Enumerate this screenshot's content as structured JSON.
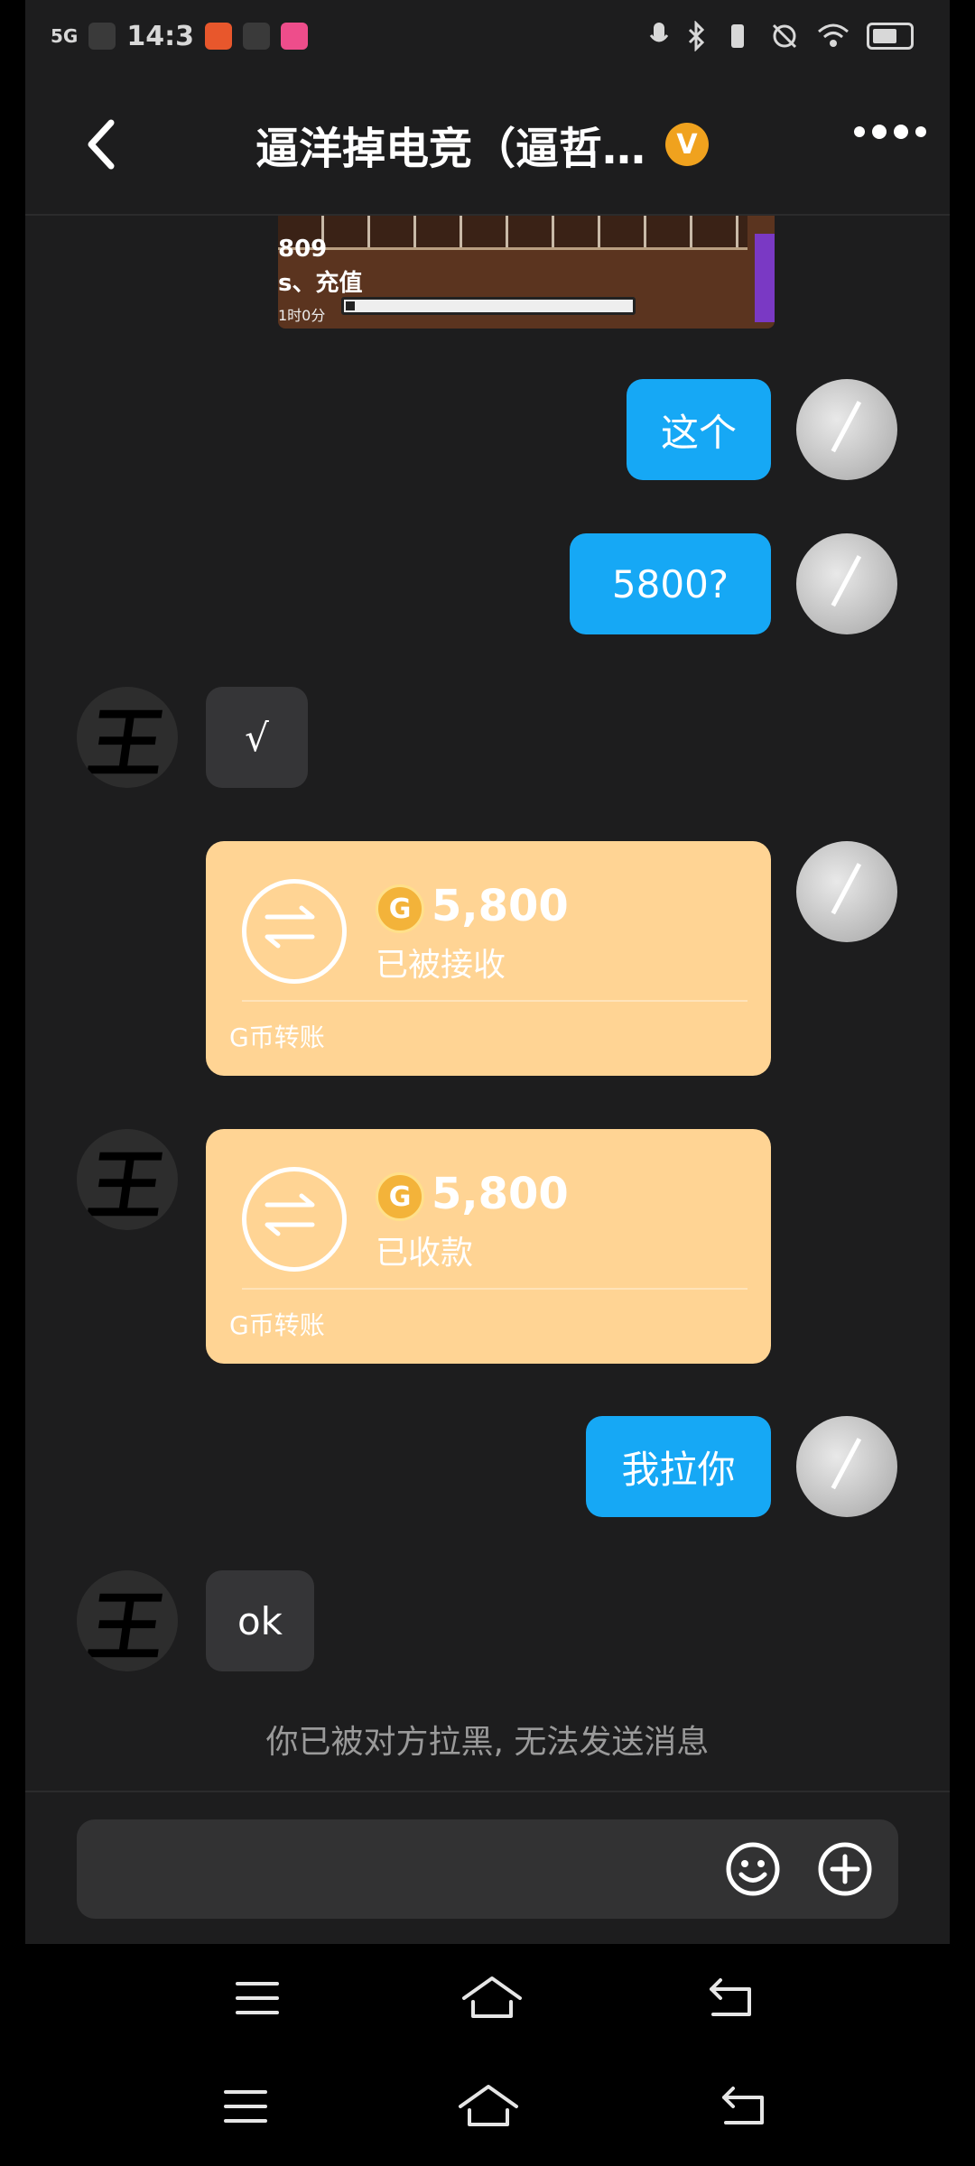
{
  "status_bar": {
    "time": "14:3",
    "network": "5G"
  },
  "header": {
    "title": "逼洋掉电竞（逼哲…",
    "badge": "V",
    "back_icon": "chevron-left-icon",
    "more_icon": "more-dots-icon"
  },
  "image_message": {
    "line1": "809",
    "line2": "s、充值",
    "line3": "1时0分"
  },
  "messages": [
    {
      "sender": "me",
      "text": "这个"
    },
    {
      "sender": "me",
      "text": "5800?"
    },
    {
      "sender": "other",
      "text": "√"
    },
    {
      "sender": "me",
      "type": "transfer",
      "amount": "5,800",
      "status": "已被接收",
      "label": "G币转账",
      "coin": "G"
    },
    {
      "sender": "other",
      "type": "transfer",
      "amount": "5,800",
      "status": "已收款",
      "label": "G币转账",
      "coin": "G"
    },
    {
      "sender": "me",
      "text": "我拉你"
    },
    {
      "sender": "other",
      "text": "ok"
    }
  ],
  "other_avatar_char": "王",
  "notice": "你已被对方拉黑, 无法发送消息",
  "input": {
    "placeholder": "",
    "emoji_icon": "emoji-smile-icon",
    "plus_icon": "plus-circle-icon"
  },
  "colors": {
    "background": "#1d1d1e",
    "my_bubble": "#16a8f5",
    "other_bubble": "#353537",
    "transfer_card": "#ffd494",
    "badge": "#f0a21e"
  }
}
